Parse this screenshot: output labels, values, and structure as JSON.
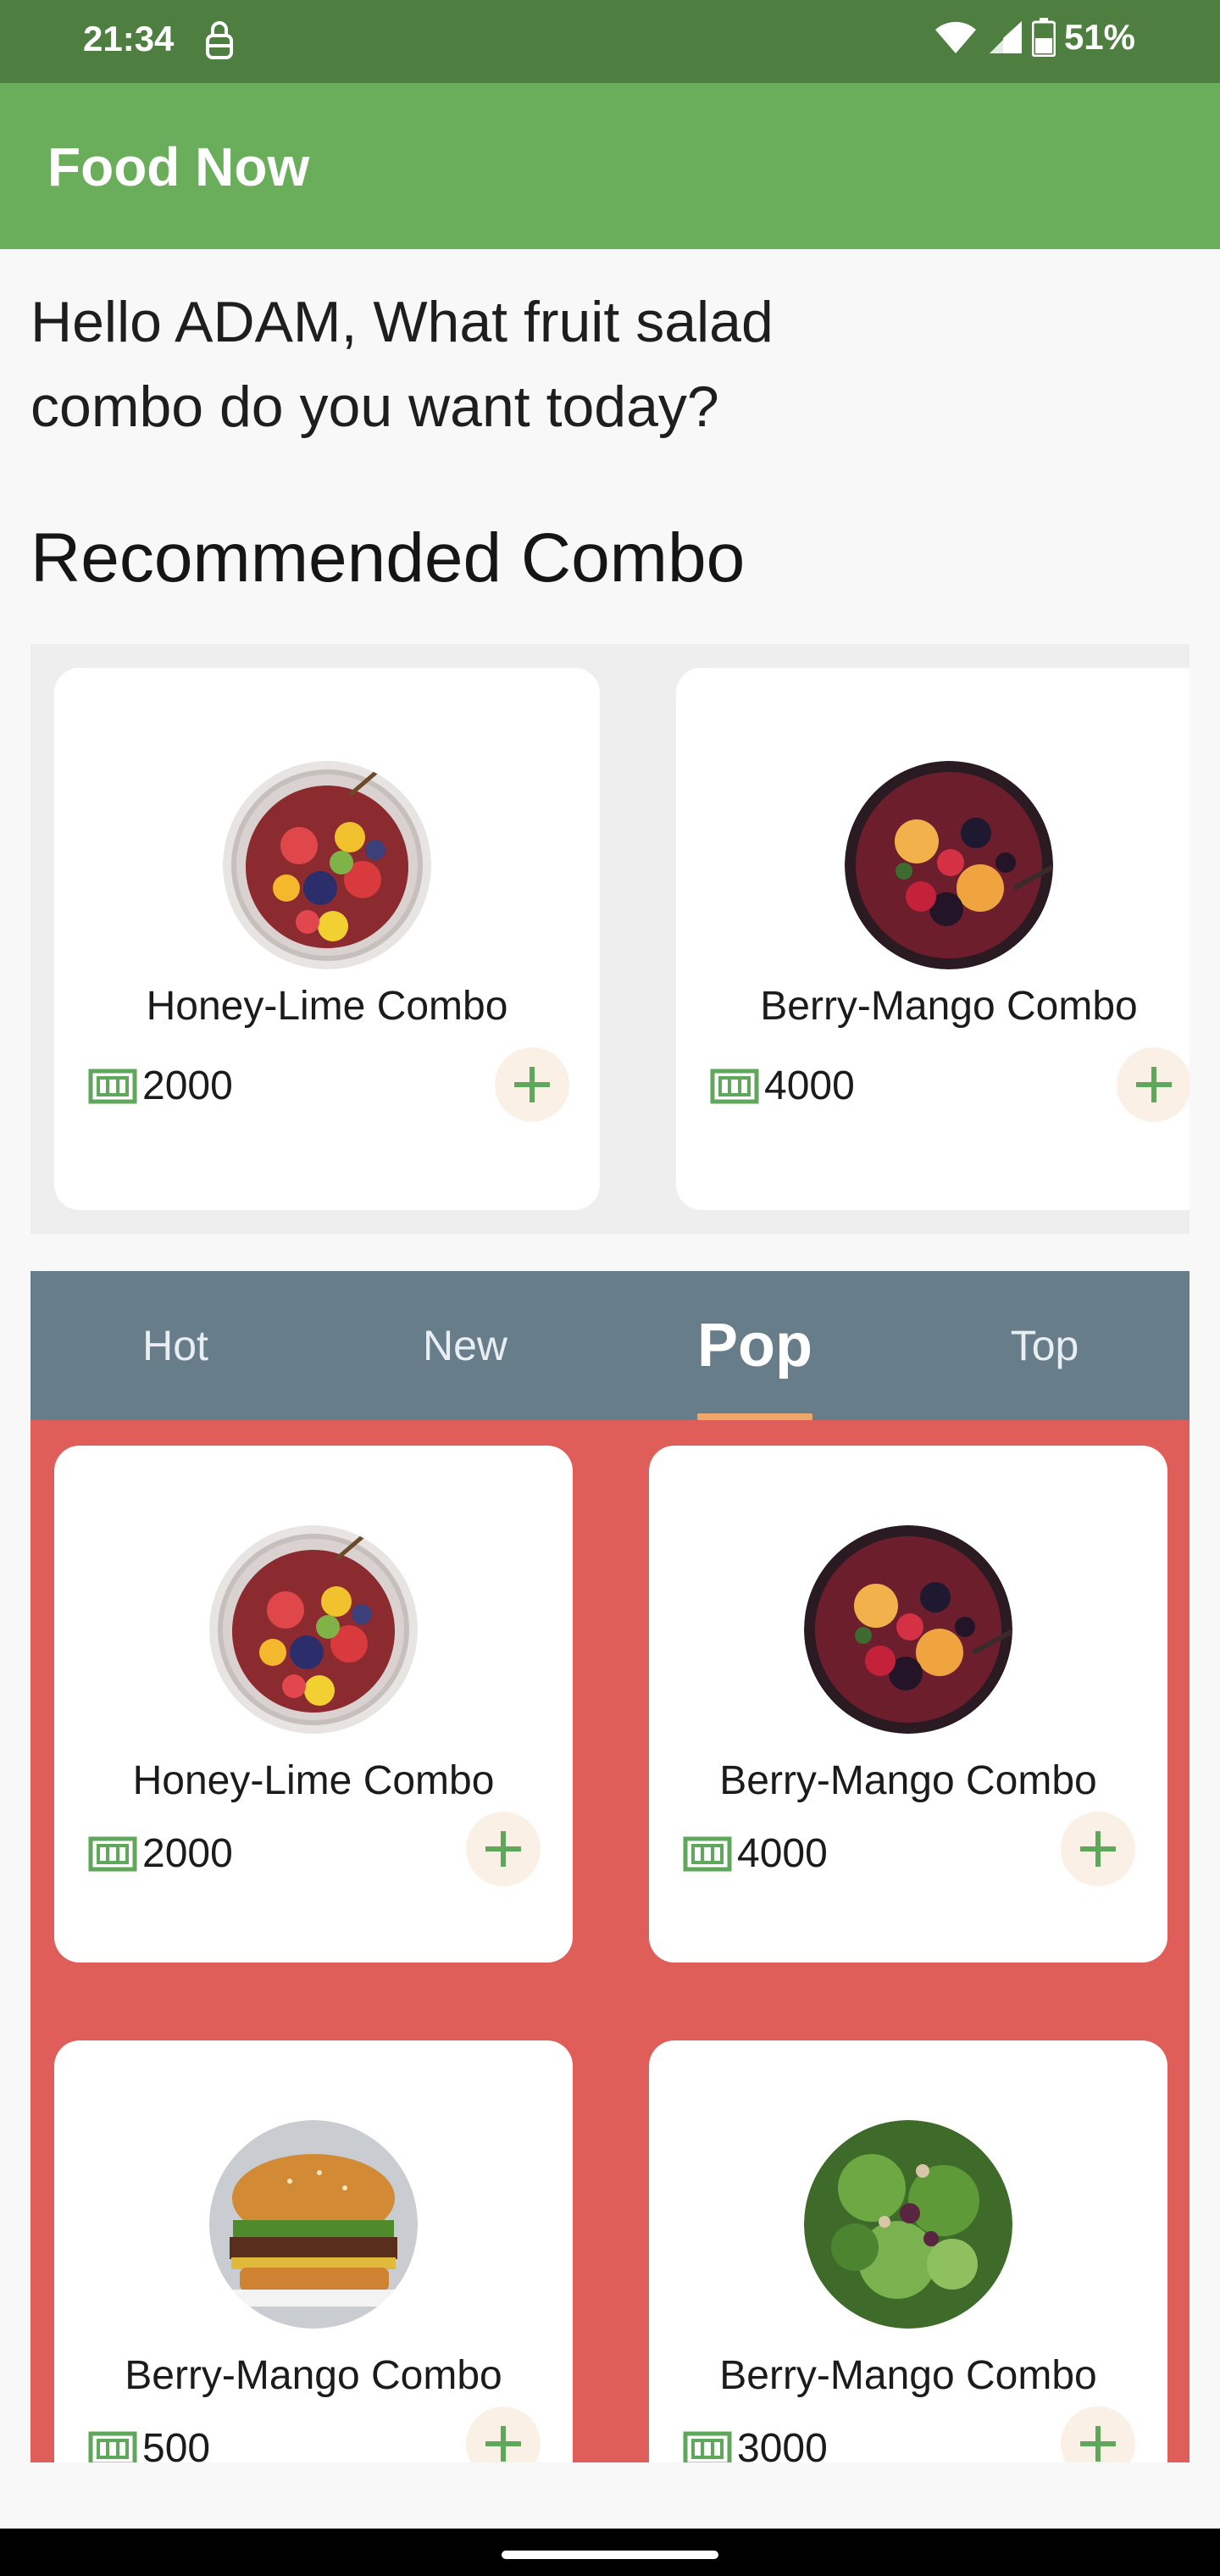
{
  "status_bar": {
    "time": "21:34",
    "battery": "51%"
  },
  "app_bar": {
    "title": "Food Now"
  },
  "greeting": "Hello ADAM, What fruit salad combo do you want today?",
  "recommended": {
    "title": "Recommended Combo",
    "items": [
      {
        "name": "Honey-Lime Combo",
        "price": "2000",
        "image": "fruit-salad-bowl"
      },
      {
        "name": "Berry-Mango Combo",
        "price": "4000",
        "image": "berry-mango-bowl"
      }
    ]
  },
  "tabs": [
    {
      "label": "Hot",
      "active": false
    },
    {
      "label": "New",
      "active": false
    },
    {
      "label": "Pop",
      "active": true
    },
    {
      "label": "Top",
      "active": false
    }
  ],
  "grid_items": [
    {
      "name": "Honey-Lime Combo",
      "price": "2000",
      "image": "fruit-salad-bowl"
    },
    {
      "name": "Berry-Mango Combo",
      "price": "4000",
      "image": "berry-mango-bowl"
    },
    {
      "name": "Berry-Mango Combo",
      "price": "500",
      "image": "burger"
    },
    {
      "name": "Berry-Mango Combo",
      "price": "3000",
      "image": "green-salad"
    }
  ],
  "colors": {
    "status_bar": "#4f7f40",
    "app_bar": "#6aae5c",
    "tabs_bg": "#687d8a",
    "tab_indicator": "#f0a868",
    "grid_bg": "#e05e59",
    "accent_green": "#5fa75a"
  },
  "icons": {
    "price": "money-bill-icon",
    "add": "plus-icon",
    "wifi": "wifi-icon",
    "signal": "signal-icon",
    "battery": "battery-icon",
    "lock": "lock-icon"
  }
}
